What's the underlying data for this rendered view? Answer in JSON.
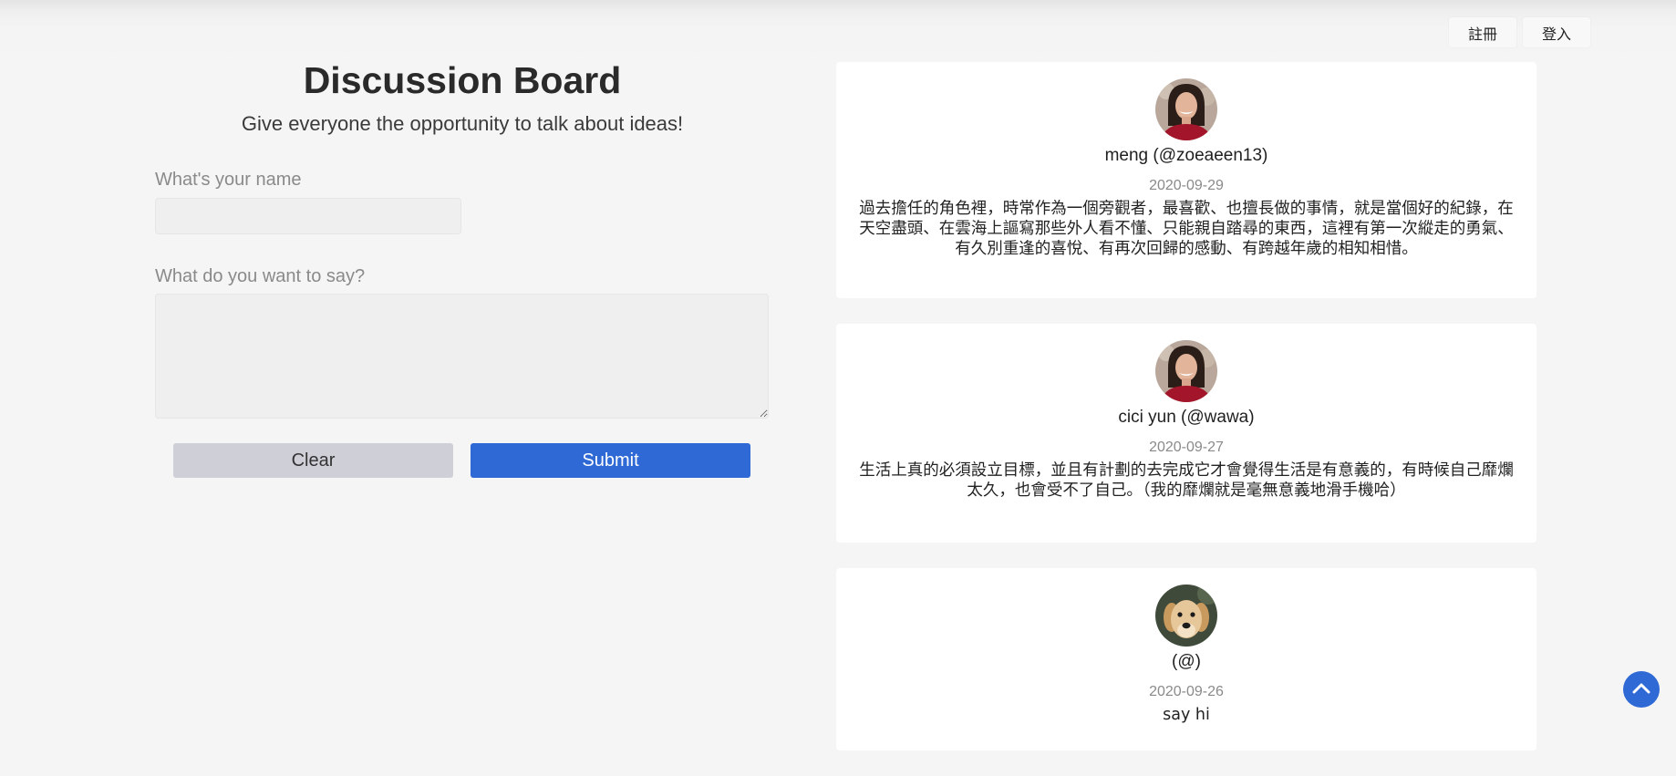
{
  "header": {
    "register_label": "註冊",
    "login_label": "登入"
  },
  "board": {
    "title": "Discussion Board",
    "subtitle": "Give everyone the opportunity to talk about ideas!"
  },
  "form": {
    "name_label": "What's your name",
    "name_value": "",
    "message_label": "What do you want to say?",
    "message_value": "",
    "clear_label": "Clear",
    "submit_label": "Submit"
  },
  "posts": [
    {
      "author": "meng (@zoeaeen13)",
      "date": "2020-09-29",
      "content": "過去擔任的角色裡，時常作為一個旁觀者，最喜歡、也擅長做的事情，就是當個好的紀錄，在天空盡頭、在雲海上謳寫那些外人看不懂、只能親自踏尋的東西，這裡有第一次縱走的勇氣、有久別重逢的喜悅、有再次回歸的感動、有跨越年歲的相知相惜。",
      "avatar_icon": "woman-avatar-icon"
    },
    {
      "author": "cici yun (@wawa)",
      "date": "2020-09-27",
      "content": "生活上真的必須設立目標，並且有計劃的去完成它才會覺得生活是有意義的，有時候自己靡爛太久，也會受不了自己。（我的靡爛就是毫無意義地滑手機哈）",
      "avatar_icon": "woman-avatar-icon"
    },
    {
      "author": "(@)",
      "date": "2020-09-26",
      "content": "say hi",
      "avatar_icon": "dog-avatar-icon"
    }
  ],
  "colors": {
    "accent": "#2e69d6",
    "clear_button": "#cfcfd8",
    "background": "#f5f5f5"
  },
  "scroll_top_icon": "chevron-up-icon"
}
